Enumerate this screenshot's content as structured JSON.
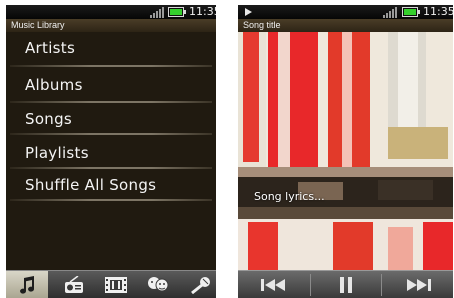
{
  "library": {
    "status": {
      "time": "11:35"
    },
    "title": "Music Library",
    "menu": [
      {
        "label": "Artists"
      },
      {
        "label": "Albums"
      },
      {
        "label": "Songs"
      },
      {
        "label": "Playlists"
      },
      {
        "label": "Shuffle All Songs"
      }
    ],
    "tabs": [
      {
        "icon": "music-note-icon",
        "active": true
      },
      {
        "icon": "radio-icon",
        "active": false
      },
      {
        "icon": "film-icon",
        "active": false
      },
      {
        "icon": "people-icon",
        "active": false
      },
      {
        "icon": "microphone-icon",
        "active": false
      }
    ]
  },
  "player": {
    "status": {
      "time": "11:35",
      "indicator": "play-indicator-icon"
    },
    "song_title": "Song title",
    "lyrics": "Song lyrics...",
    "controls": [
      {
        "icon": "previous-track-icon"
      },
      {
        "icon": "pause-icon"
      },
      {
        "icon": "next-track-icon"
      }
    ]
  },
  "colors": {
    "battery": "#35d02d",
    "menu_background": "#201a10",
    "art_red": "#e8282a"
  }
}
